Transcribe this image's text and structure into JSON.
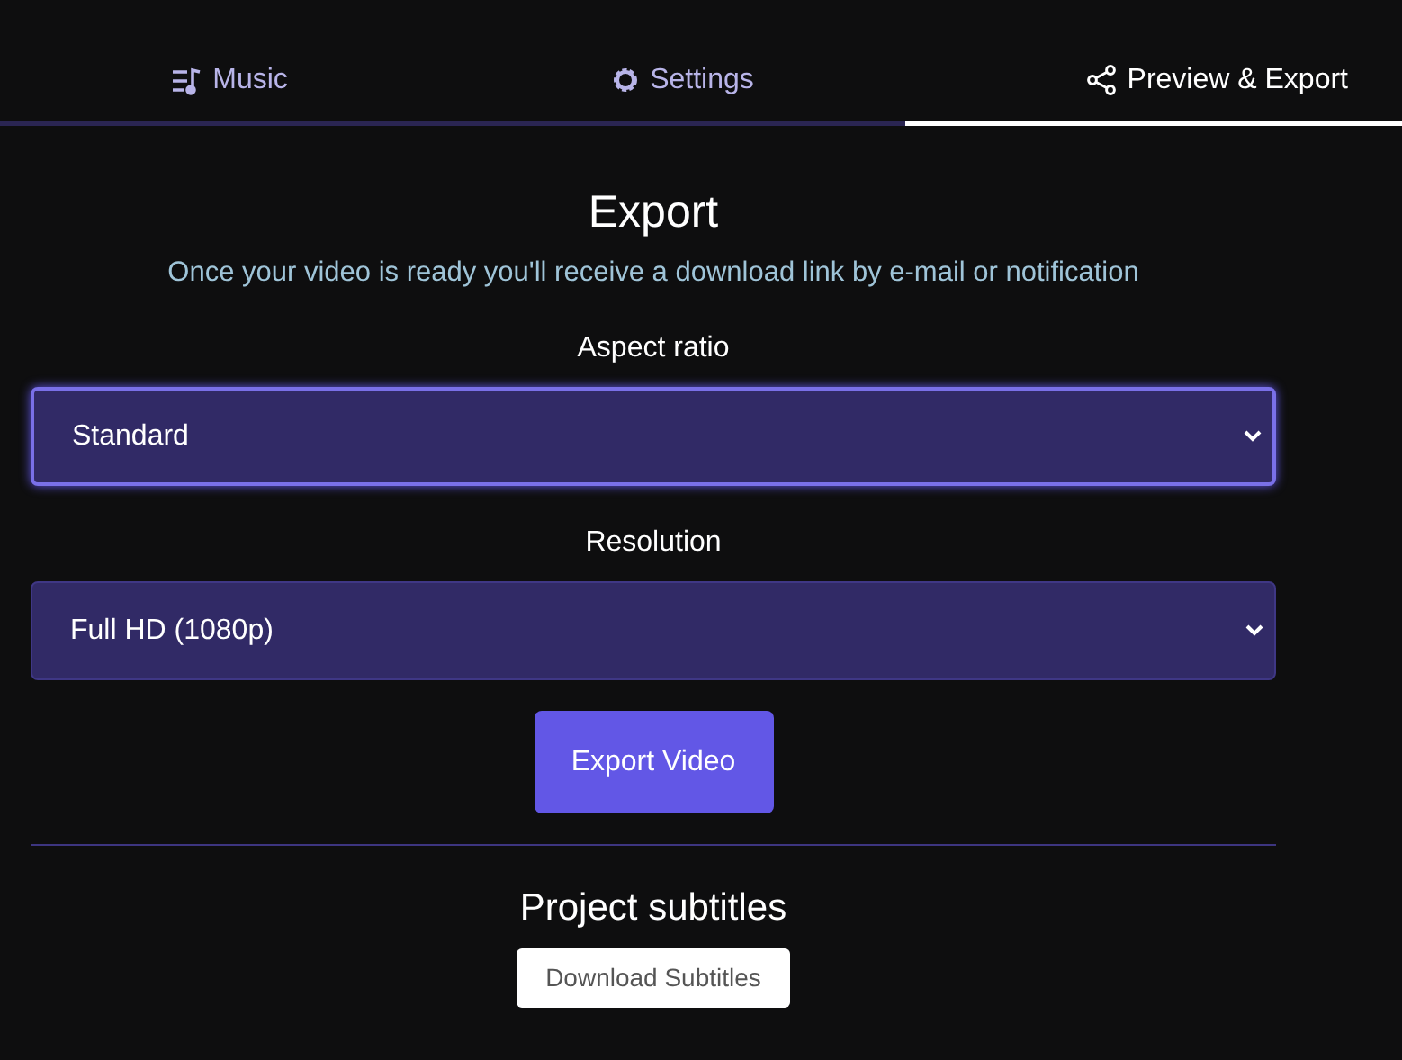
{
  "tabs": [
    {
      "label": "Music",
      "selected": false
    },
    {
      "label": "Settings",
      "selected": false
    },
    {
      "label": "Preview & Export",
      "selected": true
    }
  ],
  "export": {
    "title": "Export",
    "note": "Once your video is ready you'll receive a download link by e-mail or notification",
    "fields": [
      {
        "label": "Aspect ratio",
        "value": "Standard",
        "focused": true
      },
      {
        "label": "Resolution",
        "value": "Full HD (1080p)",
        "focused": false
      }
    ],
    "button": "Export Video"
  },
  "subtitles": {
    "title": "Project subtitles",
    "button": "Download Subtitles"
  }
}
